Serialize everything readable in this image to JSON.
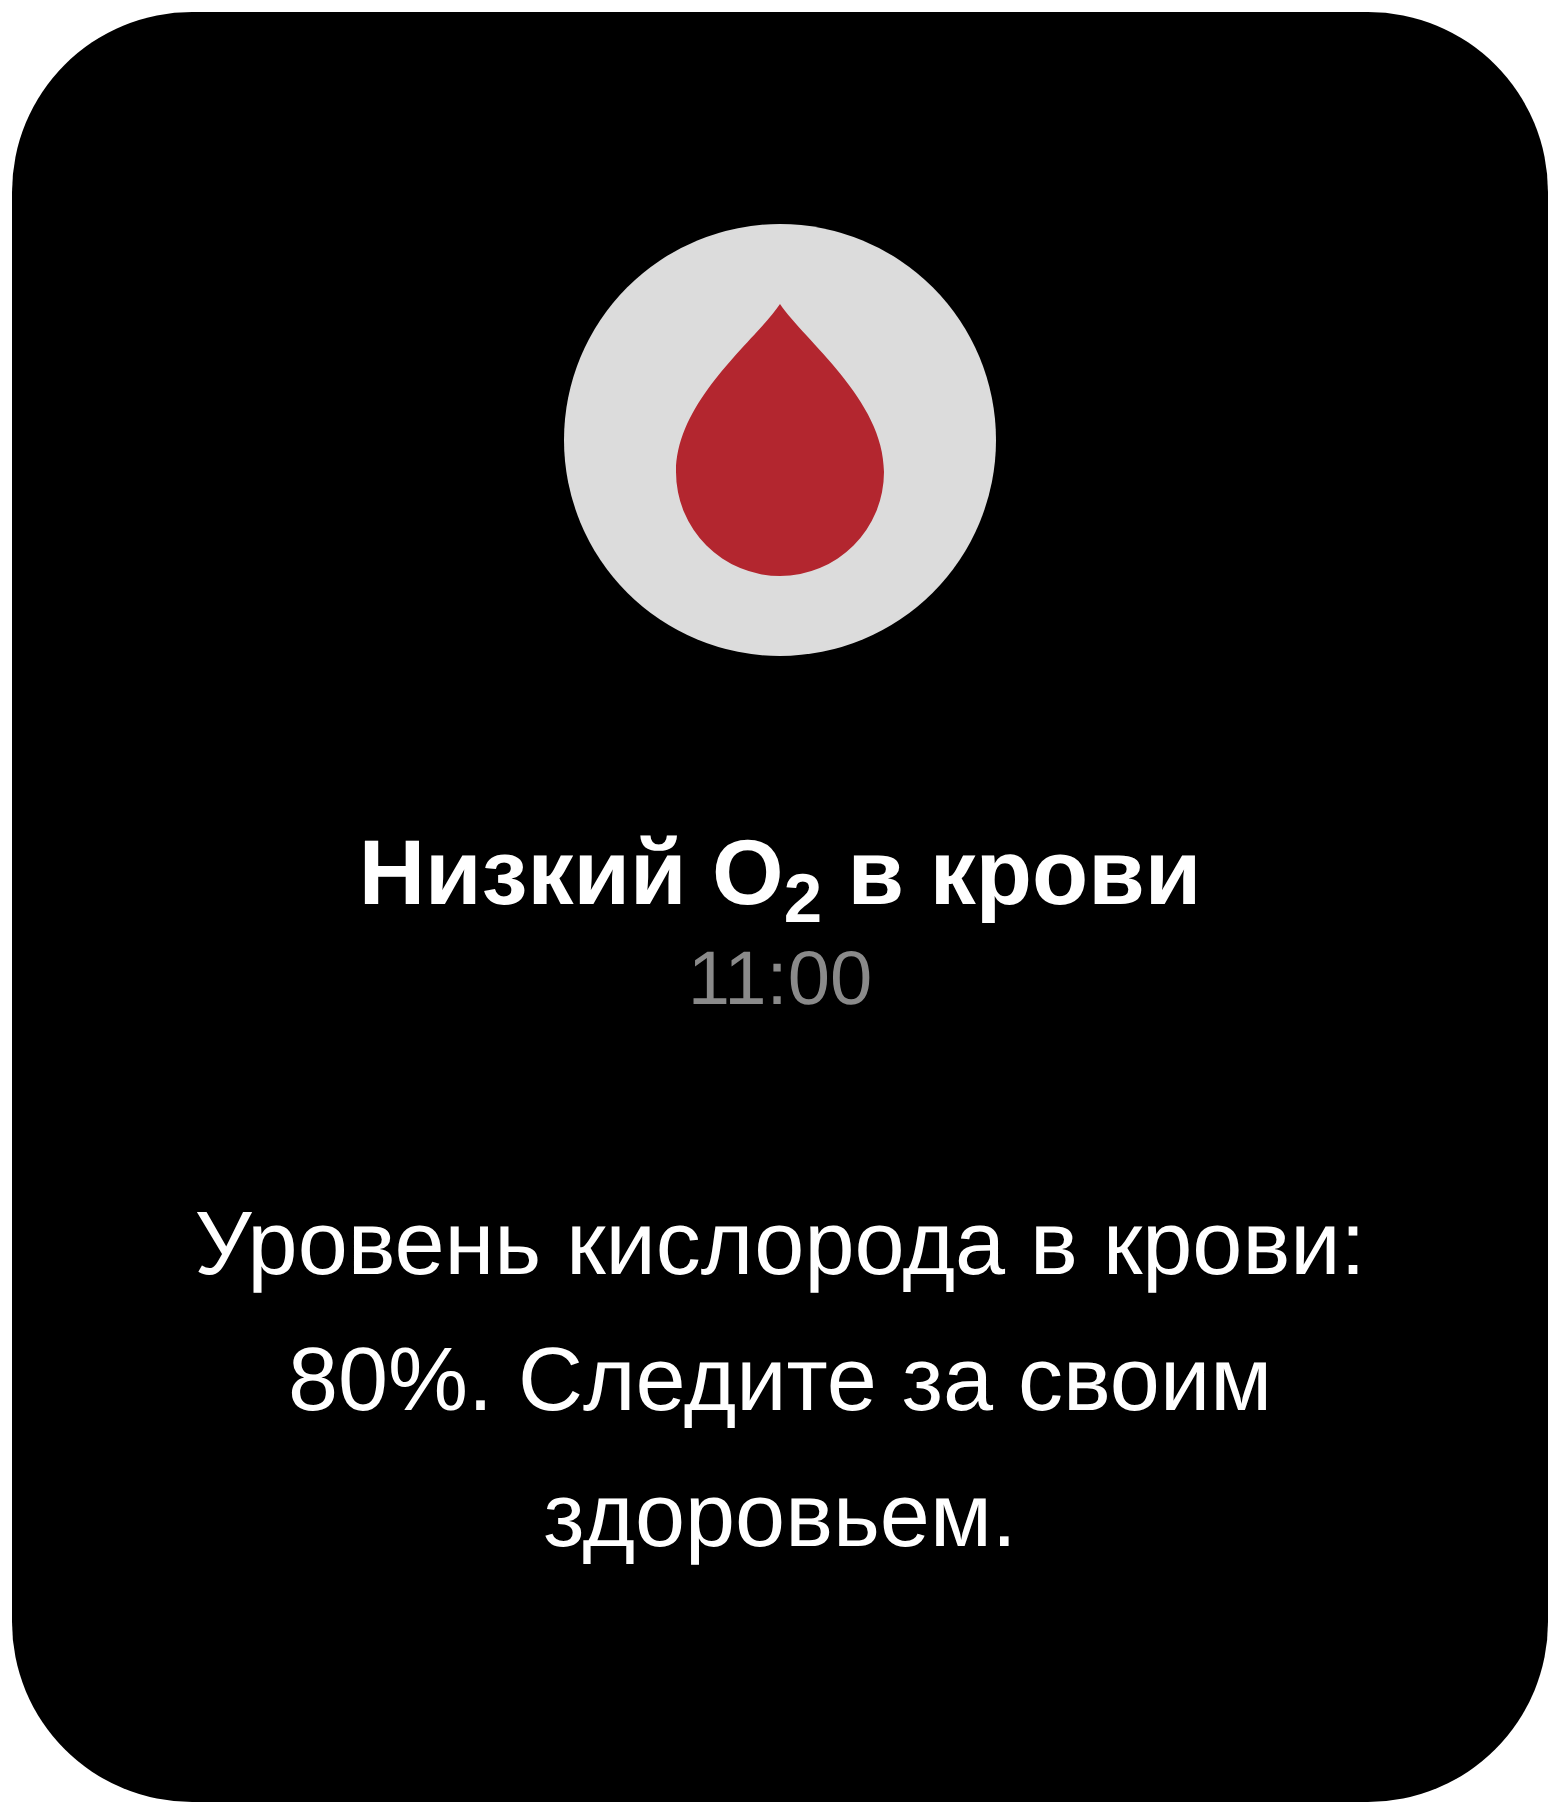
{
  "notification": {
    "title": "Низкий O$_{2}$ в крови",
    "time": "11:00",
    "message": "Уровень кислорода в крови: 80%. Следите за своим здоровьем."
  }
}
